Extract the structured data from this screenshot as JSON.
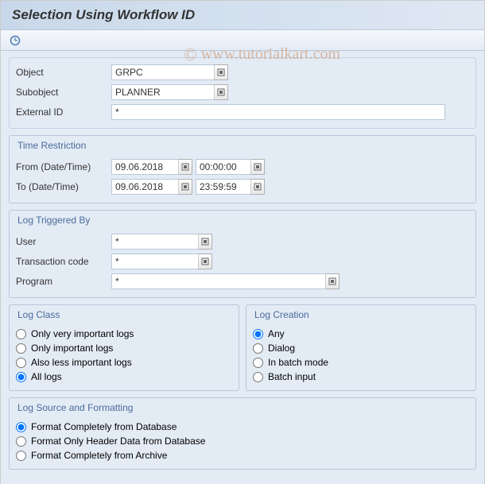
{
  "title": "Selection Using Workflow ID",
  "watermark": "www.tutorialkart.com",
  "fields": {
    "object": {
      "label": "Object",
      "value": "GRPC"
    },
    "subobject": {
      "label": "Subobject",
      "value": "PLANNER"
    },
    "external_id": {
      "label": "External ID",
      "value": "*"
    }
  },
  "time_restriction": {
    "legend": "Time Restriction",
    "from": {
      "label": "From (Date/Time)",
      "date": "09.06.2018",
      "time": "00:00:00"
    },
    "to": {
      "label": "To (Date/Time)",
      "date": "09.06.2018",
      "time": "23:59:59"
    }
  },
  "log_triggered_by": {
    "legend": "Log Triggered By",
    "user": {
      "label": "User",
      "value": "*"
    },
    "tcode": {
      "label": "Transaction code",
      "value": "*"
    },
    "program": {
      "label": "Program",
      "value": "*"
    }
  },
  "log_class": {
    "legend": "Log Class",
    "options": [
      {
        "label": "Only very important logs",
        "selected": false
      },
      {
        "label": "Only important logs",
        "selected": false
      },
      {
        "label": "Also less important logs",
        "selected": false
      },
      {
        "label": "All logs",
        "selected": true
      }
    ]
  },
  "log_creation": {
    "legend": "Log Creation",
    "options": [
      {
        "label": "Any",
        "selected": true
      },
      {
        "label": "Dialog",
        "selected": false
      },
      {
        "label": "In batch mode",
        "selected": false
      },
      {
        "label": "Batch input",
        "selected": false
      }
    ]
  },
  "log_source": {
    "legend": "Log Source and Formatting",
    "options": [
      {
        "label": "Format Completely from Database",
        "selected": true
      },
      {
        "label": "Format Only Header Data from Database",
        "selected": false
      },
      {
        "label": "Format Completely from Archive",
        "selected": false
      }
    ]
  }
}
